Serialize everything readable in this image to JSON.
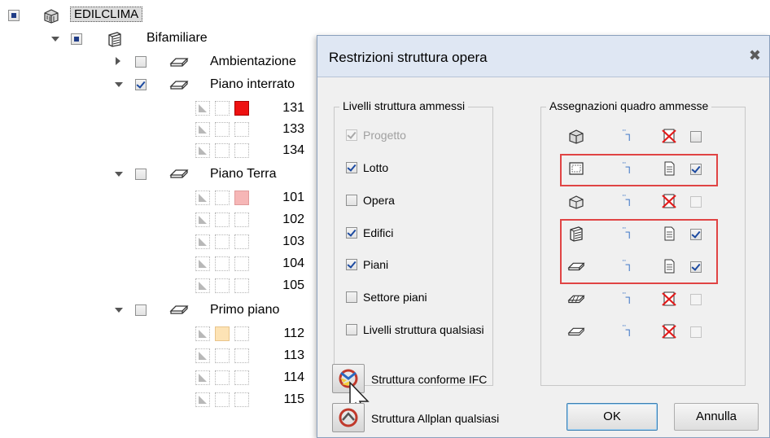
{
  "tree": {
    "root": {
      "label": "EDILCLIMA"
    },
    "building": {
      "label": "Bifamiliare"
    },
    "floors": [
      {
        "label": "Ambientazione",
        "expanded": false,
        "checked": false,
        "rooms": []
      },
      {
        "label": "Piano interrato",
        "expanded": true,
        "checked": true,
        "rooms": [
          {
            "num": "131",
            "color": "red"
          },
          {
            "num": "133",
            "color": "none"
          },
          {
            "num": "134",
            "color": "none"
          }
        ]
      },
      {
        "label": "Piano Terra",
        "expanded": true,
        "checked": false,
        "rooms": [
          {
            "num": "101",
            "color": "pink"
          },
          {
            "num": "102",
            "color": "none"
          },
          {
            "num": "103",
            "color": "none"
          },
          {
            "num": "104",
            "color": "none"
          },
          {
            "num": "105",
            "color": "none"
          }
        ]
      },
      {
        "label": "Primo piano",
        "expanded": true,
        "checked": false,
        "rooms": [
          {
            "num": "112",
            "color": "peach"
          },
          {
            "num": "113",
            "color": "none"
          },
          {
            "num": "114",
            "color": "none"
          },
          {
            "num": "115",
            "color": "none"
          }
        ]
      }
    ]
  },
  "dialog": {
    "title": "Restrizioni struttura opera",
    "close_label": "✖",
    "levels_group": {
      "label": "Livelli struttura ammessi",
      "options": [
        {
          "label": "Progetto",
          "checked": true,
          "disabled": true
        },
        {
          "label": "Lotto",
          "checked": true,
          "disabled": false
        },
        {
          "label": "Opera",
          "checked": false,
          "disabled": false
        },
        {
          "label": "Edifici",
          "checked": true,
          "disabled": false
        },
        {
          "label": "Piani",
          "checked": true,
          "disabled": false
        },
        {
          "label": "Settore piani",
          "checked": false,
          "disabled": false
        },
        {
          "label": "Livelli struttura qualsiasi",
          "checked": false,
          "disabled": false
        }
      ]
    },
    "assign_group": {
      "label": "Assegnazioni quadro ammesse",
      "rows": [
        {
          "icon": "project-icon",
          "allowed": false,
          "checked": false,
          "disabled": false
        },
        {
          "icon": "lot-icon",
          "allowed": true,
          "checked": true,
          "disabled": false
        },
        {
          "icon": "work-icon",
          "allowed": false,
          "checked": false,
          "disabled": true
        },
        {
          "icon": "building-icon",
          "allowed": true,
          "checked": true,
          "disabled": false
        },
        {
          "icon": "floor-icon",
          "allowed": true,
          "checked": true,
          "disabled": false
        },
        {
          "icon": "floor-sector-icon",
          "allowed": false,
          "checked": false,
          "disabled": true
        },
        {
          "icon": "generic-level-icon",
          "allowed": false,
          "checked": false,
          "disabled": true
        }
      ]
    },
    "ifc_button": {
      "label": "Struttura conforme IFC"
    },
    "allplan_button": {
      "label": "Struttura Allplan qualsiasi"
    },
    "ok_label": "OK",
    "cancel_label": "Annulla"
  },
  "colors": {
    "highlight": "#e04444",
    "accent": "#1c4aa0",
    "room_red": "#ee1111",
    "room_pink": "#f6b6b6",
    "room_peach": "#fde3b5"
  }
}
